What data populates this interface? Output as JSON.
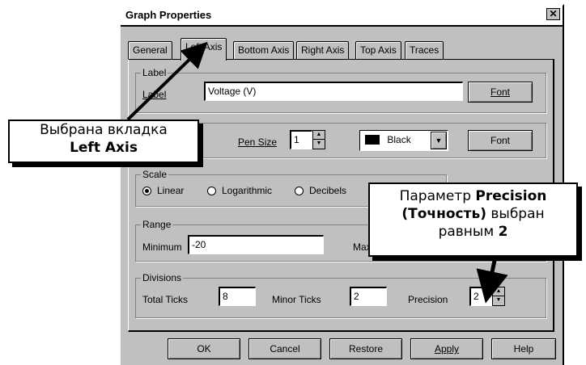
{
  "window": {
    "title": "Graph Properties",
    "close_glyph": "✕"
  },
  "tabs": [
    "General",
    "Left Axis",
    "Bottom Axis",
    "Right Axis",
    "Top Axis",
    "Traces"
  ],
  "active_tab": "Left Axis",
  "label_group": {
    "legend": "Label",
    "field_label": "Label",
    "value": "Voltage (V)",
    "font_button": "Font"
  },
  "style_group": {
    "pen_size_label": "Pen Size",
    "pen_size_value": "1",
    "color_value": "Black",
    "color_swatch": "#000000",
    "font_button": "Font"
  },
  "scale_group": {
    "legend": "Scale",
    "options": [
      "Linear",
      "Logarithmic",
      "Decibels"
    ],
    "selected": "Linear"
  },
  "range_group": {
    "legend": "Range",
    "minimum_label": "Minimum",
    "minimum_value": "-20",
    "maximum_label_partial": "Max"
  },
  "divisions_group": {
    "legend": "Divisions",
    "total_ticks_label": "Total Ticks",
    "total_ticks_value": "8",
    "minor_ticks_label": "Minor Ticks",
    "minor_ticks_value": "2",
    "precision_label": "Precision",
    "precision_value": "2"
  },
  "buttons": {
    "ok": "OK",
    "cancel": "Cancel",
    "restore": "Restore",
    "apply": "Apply",
    "help": "Help"
  },
  "callouts": {
    "left_line1": "Выбрана вкладка",
    "left_line2": "Left Axis",
    "right_line1_pre": "Параметр ",
    "right_line1_bold": "Precision",
    "right_line2_bold": "(Точность)",
    "right_line2_post": " выбран",
    "right_line3_pre": "равным ",
    "right_line3_bold": "2"
  }
}
